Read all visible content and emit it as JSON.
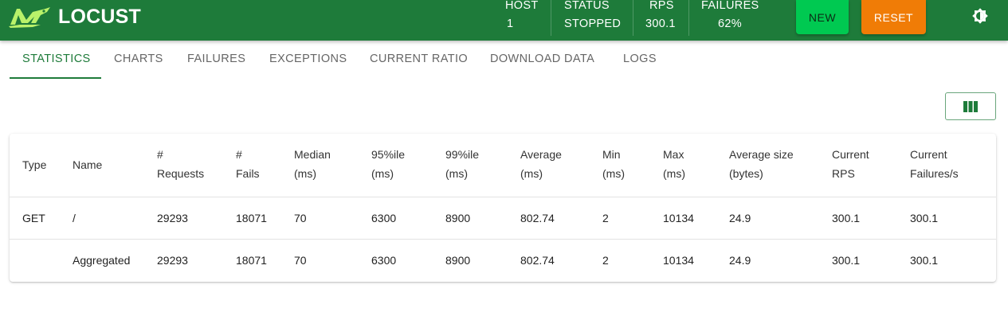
{
  "app": {
    "name": "LOCUST"
  },
  "header_stats": [
    {
      "label": "HOST",
      "value": "1"
    },
    {
      "label": "STATUS",
      "value": "STOPPED"
    },
    {
      "label": "RPS",
      "value": "300.1"
    },
    {
      "label": "FAILURES",
      "value": "62%"
    }
  ],
  "buttons": {
    "new_label": "NEW",
    "reset_label": "RESET"
  },
  "colors": {
    "header": "#1e7b3a",
    "new_button": "#00c951",
    "reset_button": "#f07c06"
  },
  "tabs": [
    {
      "label": "STATISTICS",
      "active": true
    },
    {
      "label": "CHARTS"
    },
    {
      "label": "FAILURES"
    },
    {
      "label": "EXCEPTIONS"
    },
    {
      "label": "CURRENT RATIO"
    },
    {
      "label": "DOWNLOAD DATA"
    },
    {
      "label": "LOGS"
    }
  ],
  "table": {
    "columns": [
      [
        "Type"
      ],
      [
        "Name"
      ],
      [
        "#",
        "Requests"
      ],
      [
        "#",
        "Fails"
      ],
      [
        "Median",
        "(ms)"
      ],
      [
        "95%ile",
        "(ms)"
      ],
      [
        "99%ile",
        "(ms)"
      ],
      [
        "Average",
        "(ms)"
      ],
      [
        "Min",
        "(ms)"
      ],
      [
        "Max",
        "(ms)"
      ],
      [
        "Average size",
        "(bytes)"
      ],
      [
        "Current",
        "RPS"
      ],
      [
        "Current",
        "Failures/s"
      ]
    ],
    "rows": [
      [
        "GET",
        "/",
        "29293",
        "18071",
        "70",
        "6300",
        "8900",
        "802.74",
        "2",
        "10134",
        "24.9",
        "300.1",
        "300.1"
      ],
      [
        "",
        "Aggregated",
        "29293",
        "18071",
        "70",
        "6300",
        "8900",
        "802.74",
        "2",
        "10134",
        "24.9",
        "300.1",
        "300.1"
      ]
    ]
  }
}
